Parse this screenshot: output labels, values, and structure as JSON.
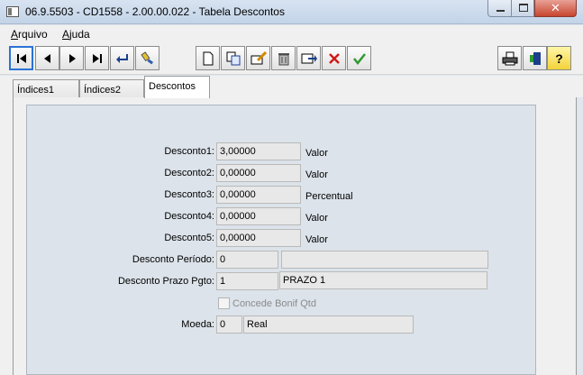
{
  "window": {
    "title": "06.9.5503 - CD1558 - 2.00.00.022 - Tabela Descontos",
    "close_glyph": "✕"
  },
  "menu": {
    "items": [
      {
        "first": "A",
        "rest": "rquivo"
      },
      {
        "first": "A",
        "rest": "juda"
      }
    ]
  },
  "toolbar": {
    "buttons": [
      "first-icon",
      "prev-icon",
      "next-icon",
      "last-icon",
      "goto-icon",
      "search-icon",
      "new-icon",
      "copy-icon",
      "edit-icon",
      "delete-icon",
      "replace-icon",
      "cancel-icon",
      "ok-icon",
      "print-icon",
      "exit-icon",
      "help-icon"
    ],
    "help_glyph": "?"
  },
  "tabs": [
    "Índices1",
    "Índices2",
    "Descontos"
  ],
  "form": {
    "discounts": [
      {
        "label": "Desconto1:",
        "value": "3,00000",
        "unit": "Valor"
      },
      {
        "label": "Desconto2:",
        "value": "0,00000",
        "unit": "Valor"
      },
      {
        "label": "Desconto3:",
        "value": "0,00000",
        "unit": "Percentual"
      },
      {
        "label": "Desconto4:",
        "value": "0,00000",
        "unit": "Valor"
      },
      {
        "label": "Desconto5:",
        "value": "0,00000",
        "unit": "Valor"
      }
    ],
    "periodo": {
      "label": "Desconto Período:",
      "code": "0",
      "desc": ""
    },
    "prazo": {
      "label": "Desconto Prazo Pgto:",
      "code": "1",
      "desc": "PRAZO 1"
    },
    "bonif": {
      "label": "Concede Bonif Qtd",
      "checked": false
    },
    "moeda": {
      "label": "Moeda:",
      "code": "0",
      "desc": "Real"
    }
  }
}
